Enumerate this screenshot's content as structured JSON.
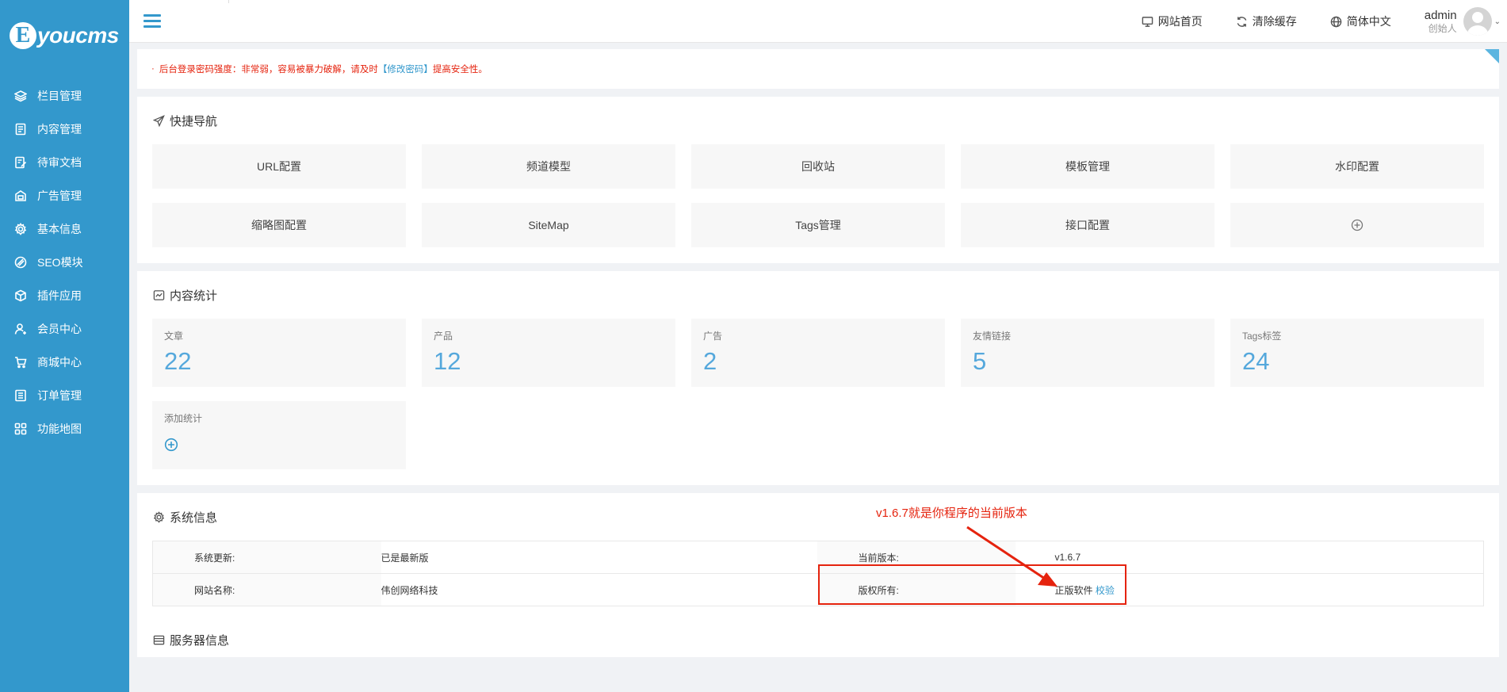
{
  "logo": {
    "mark": "E",
    "text": "youcms"
  },
  "sidebar": {
    "items": [
      {
        "label": "栏目管理",
        "icon": "layers-icon"
      },
      {
        "label": "内容管理",
        "icon": "document-icon"
      },
      {
        "label": "待审文档",
        "icon": "edit-doc-icon"
      },
      {
        "label": "广告管理",
        "icon": "ad-icon"
      },
      {
        "label": "基本信息",
        "icon": "gear-icon"
      },
      {
        "label": "SEO模块",
        "icon": "seo-icon"
      },
      {
        "label": "插件应用",
        "icon": "cube-icon"
      },
      {
        "label": "会员中心",
        "icon": "user-icon"
      },
      {
        "label": "商城中心",
        "icon": "cart-icon"
      },
      {
        "label": "订单管理",
        "icon": "list-icon"
      },
      {
        "label": "功能地图",
        "icon": "grid-icon"
      }
    ]
  },
  "topbar": {
    "site_home": "网站首页",
    "clear_cache": "清除缓存",
    "language": "简体中文",
    "user_name": "admin",
    "user_role": "创始人",
    "chevron": "⌄"
  },
  "alert": {
    "bullet": "·",
    "text_before": "后台登录密码强度：非常弱，容易被暴力破解，请及时",
    "link": "【修改密码】",
    "text_after": "提高安全性。"
  },
  "quick_nav": {
    "title": "快捷导航",
    "items": [
      "URL配置",
      "频道模型",
      "回收站",
      "模板管理",
      "水印配置",
      "缩略图配置",
      "SiteMap",
      "Tags管理",
      "接口配置"
    ]
  },
  "content_stats": {
    "title": "内容统计",
    "items": [
      {
        "label": "文章",
        "value": "22"
      },
      {
        "label": "产品",
        "value": "12"
      },
      {
        "label": "广告",
        "value": "2"
      },
      {
        "label": "友情链接",
        "value": "5"
      },
      {
        "label": "Tags标签",
        "value": "24"
      }
    ],
    "add_label": "添加统计"
  },
  "system_info": {
    "title": "系统信息",
    "update_key": "系统更新:",
    "update_val": "已是最新版",
    "version_key": "当前版本:",
    "version_val": "v1.6.7",
    "site_key": "网站名称:",
    "site_val": "伟创网络科技",
    "copyright_key": "版权所有:",
    "copyright_val": "正版软件",
    "verify_link": "校验"
  },
  "server_info": {
    "title": "服务器信息"
  },
  "annotation": {
    "text": "v1.6.7就是你程序的当前版本"
  },
  "colors": {
    "sidebar": "#3398cc",
    "accent": "#55a8dc",
    "alert": "#e5230e"
  }
}
